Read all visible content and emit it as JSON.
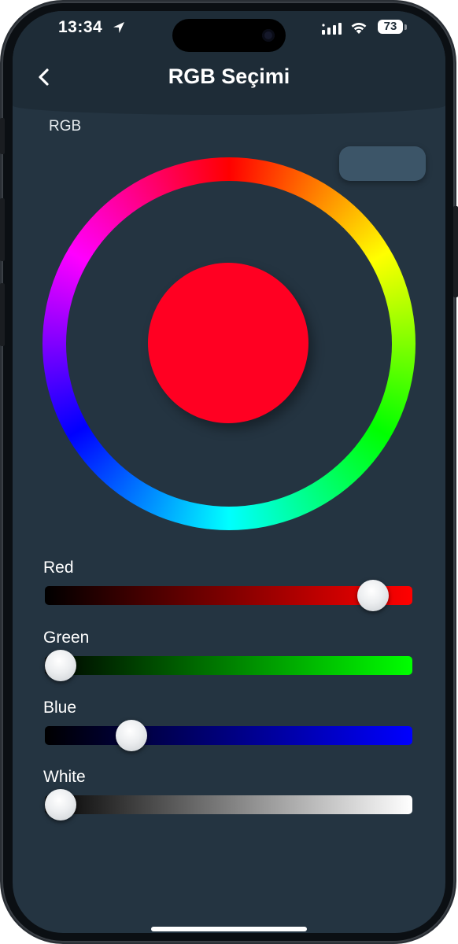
{
  "status_bar": {
    "time": "13:34",
    "battery": "73",
    "icons": [
      "location-arrow-icon",
      "cellular-signal-icon",
      "wifi-icon",
      "battery-icon"
    ]
  },
  "header": {
    "title": "RGB Seçimi",
    "back_icon": "chevron-left-icon"
  },
  "mode_label": "RGB",
  "selected_color": "#ff0022",
  "preview_button_color": "#3c5568",
  "sliders": [
    {
      "label": "Red",
      "value": 0.93,
      "gradient": [
        "#000000",
        "#ff0000"
      ]
    },
    {
      "label": "Green",
      "value": 0.0,
      "gradient": [
        "#000000",
        "#00ff00"
      ]
    },
    {
      "label": "Blue",
      "value": 0.21,
      "gradient": [
        "#000000",
        "#0000ff"
      ]
    },
    {
      "label": "White",
      "value": 0.0,
      "gradient": [
        "#000000",
        "#ffffff"
      ]
    }
  ]
}
